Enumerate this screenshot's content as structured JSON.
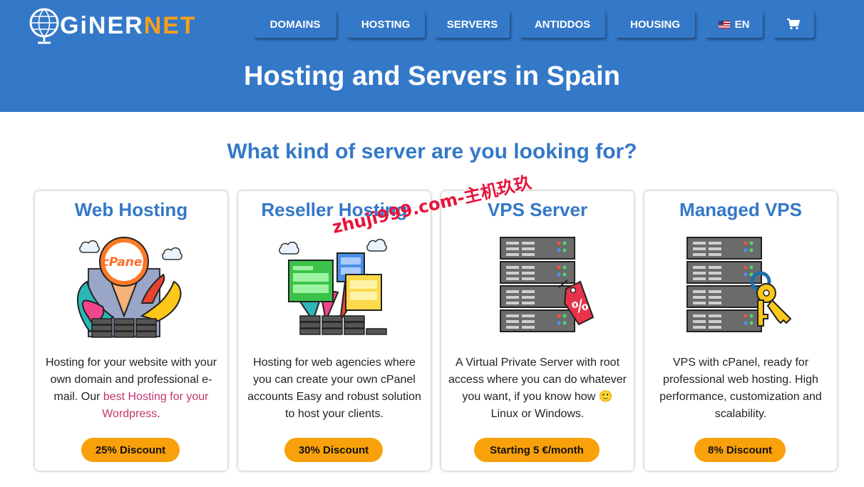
{
  "brand": {
    "name_white": "GiNER",
    "name_yellow": "NET"
  },
  "nav": {
    "items": [
      "DOMAINS",
      "HOSTING",
      "SERVERS",
      "ANTIDDOS",
      "HOUSING"
    ],
    "language": "EN",
    "cart_icon": "cart-icon"
  },
  "hero": {
    "title": "Hosting and Servers in Spain"
  },
  "section": {
    "title": "What kind of server are you looking for?"
  },
  "cards": [
    {
      "title": "Web Hosting",
      "illustration_label": "cPanel",
      "desc_before": "Hosting for your website with your own domain and professional e-mail. Our ",
      "desc_link": "best Hosting for your Wordpress",
      "desc_after": ".",
      "badge": "25% Discount"
    },
    {
      "title": "Reseller Hosting",
      "desc": "Hosting for web agencies where you can create your own cPanel accounts Easy and robust solution to host your clients.",
      "badge": "30% Discount"
    },
    {
      "title": "VPS Server",
      "desc_before": "A Virtual Private Server with root access where you can do whatever you want, if you know how ",
      "emoji": "🙂",
      "desc_after": " Linux or Windows.",
      "badge": "Starting 5 €/month"
    },
    {
      "title": "Managed VPS",
      "desc": "VPS with cPanel, ready for professional web hosting. High performance, customization and scalability.",
      "badge": "8% Discount"
    }
  ],
  "watermark": "zhuji999.com-主机玖玖",
  "colors": {
    "primary": "#3478c8",
    "accent": "#f9a10a",
    "link": "#c2366e",
    "logo_yellow": "#f6a11b"
  }
}
